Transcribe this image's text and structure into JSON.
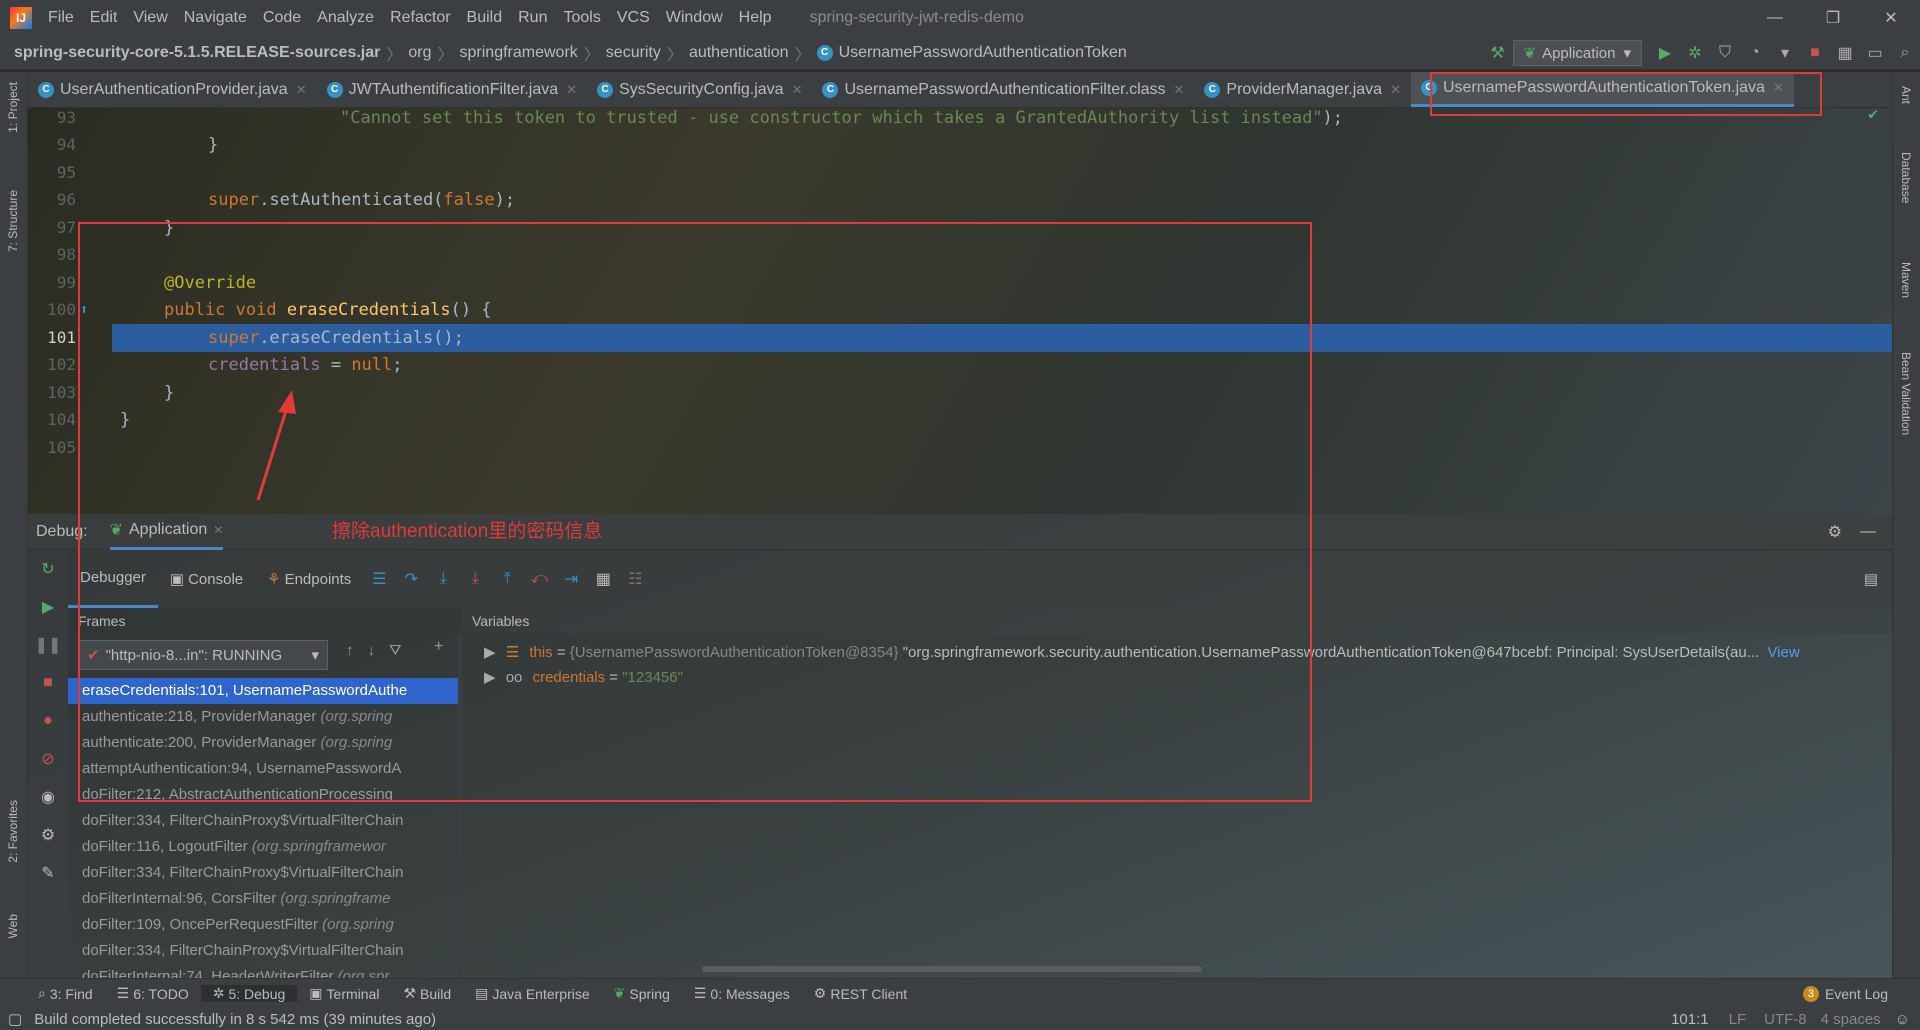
{
  "menu": [
    "File",
    "Edit",
    "View",
    "Navigate",
    "Code",
    "Analyze",
    "Refactor",
    "Build",
    "Run",
    "Tools",
    "VCS",
    "Window",
    "Help"
  ],
  "project_name": "spring-security-jwt-redis-demo",
  "breadcrumb": [
    "spring-security-core-5.1.5.RELEASE-sources.jar",
    "org",
    "springframework",
    "security",
    "authentication",
    "UsernamePasswordAuthenticationToken"
  ],
  "run_config": "Application",
  "tabs": [
    {
      "label": "UserAuthenticationProvider.java"
    },
    {
      "label": "JWTAuthentificationFilter.java"
    },
    {
      "label": "SysSecurityConfig.java"
    },
    {
      "label": "UsernamePasswordAuthenticationFilter.class"
    },
    {
      "label": "ProviderManager.java"
    },
    {
      "label": "UsernamePasswordAuthenticationToken.java"
    }
  ],
  "left_tools": [
    "1: Project",
    "7: Structure",
    "2: Favorites",
    "Web"
  ],
  "right_tools": [
    "Ant",
    "Database",
    "Maven",
    "Bean Validation"
  ],
  "line_numbers": [
    "93",
    "94",
    "95",
    "96",
    "97",
    "98",
    "99",
    "100",
    "101",
    "102",
    "103",
    "104",
    "105"
  ],
  "code": {
    "l93": "\"Cannot set this token to trusted - use constructor which takes a GrantedAuthority list instead\"",
    "l93_end": ");",
    "l94": "}",
    "l96_super": "super",
    "l96_call": ".setAuthenticated(",
    "l96_false": "false",
    "l96_end": ");",
    "l97": "}",
    "l99": "@Override",
    "l100_kw": "public void ",
    "l100_fn": "eraseCredentials",
    "l100_end": "() {",
    "l101_super": "super",
    "l101_call": ".eraseCredentials();",
    "l102_fld": "credentials",
    "l102_eq": " = ",
    "l102_null": "null",
    "l102_end": ";",
    "l103": "}",
    "l104": "}"
  },
  "debug": {
    "label": "Debug:",
    "session": "Application",
    "annotation": "擦除authentication里的密码信息",
    "tabs": [
      "Debugger",
      "Console",
      "Endpoints"
    ],
    "frames_header": "Frames",
    "variables_header": "Variables",
    "thread": "\"http-nio-8...in\": RUNNING",
    "frames": [
      {
        "main": "eraseCredentials:101, UsernamePasswordAuthe",
        "pkg": ""
      },
      {
        "main": "authenticate:218, ProviderManager ",
        "pkg": "(org.spring"
      },
      {
        "main": "authenticate:200, ProviderManager ",
        "pkg": "(org.spring"
      },
      {
        "main": "attemptAuthentication:94, UsernamePasswordA",
        "pkg": ""
      },
      {
        "main": "doFilter:212, AbstractAuthenticationProcessing",
        "pkg": ""
      },
      {
        "main": "doFilter:334, FilterChainProxy$VirtualFilterChain",
        "pkg": ""
      },
      {
        "main": "doFilter:116, LogoutFilter ",
        "pkg": "(org.springframewor"
      },
      {
        "main": "doFilter:334, FilterChainProxy$VirtualFilterChain",
        "pkg": ""
      },
      {
        "main": "doFilterInternal:96, CorsFilter ",
        "pkg": "(org.springframe"
      },
      {
        "main": "doFilter:109, OncePerRequestFilter ",
        "pkg": "(org.spring"
      },
      {
        "main": "doFilter:334, FilterChainProxy$VirtualFilterChain",
        "pkg": ""
      },
      {
        "main": "doFilterInternal:74, HeaderWriterFilter ",
        "pkg": "(org.spr"
      }
    ],
    "variables": [
      {
        "name": "this",
        "eq": " = ",
        "type": "{UsernamePasswordAuthenticationToken@8354} ",
        "value": "\"org.springframework.security.authentication.UsernamePasswordAuthenticationToken@647bcebf: Principal: SysUserDetails(au...",
        "link": "View"
      },
      {
        "name": "credentials",
        "eq": " = ",
        "type": "",
        "value": "\"123456\"",
        "link": ""
      }
    ]
  },
  "bottom_tools": [
    "3: Find",
    "6: TODO",
    "5: Debug",
    "Terminal",
    "Build",
    "Java Enterprise",
    "Spring",
    "0: Messages",
    "REST Client"
  ],
  "event_log": "Event Log",
  "event_count": "3",
  "status": {
    "message": "Build completed successfully in 8 s 542 ms (39 minutes ago)",
    "position": "101:1",
    "line_sep": "LF",
    "encoding": "UTF-8",
    "indent": "4 spaces"
  },
  "colors": {
    "accent": "#2f65ca",
    "annotation_red": "#e03a3a",
    "selection": "#2c5d9e"
  }
}
